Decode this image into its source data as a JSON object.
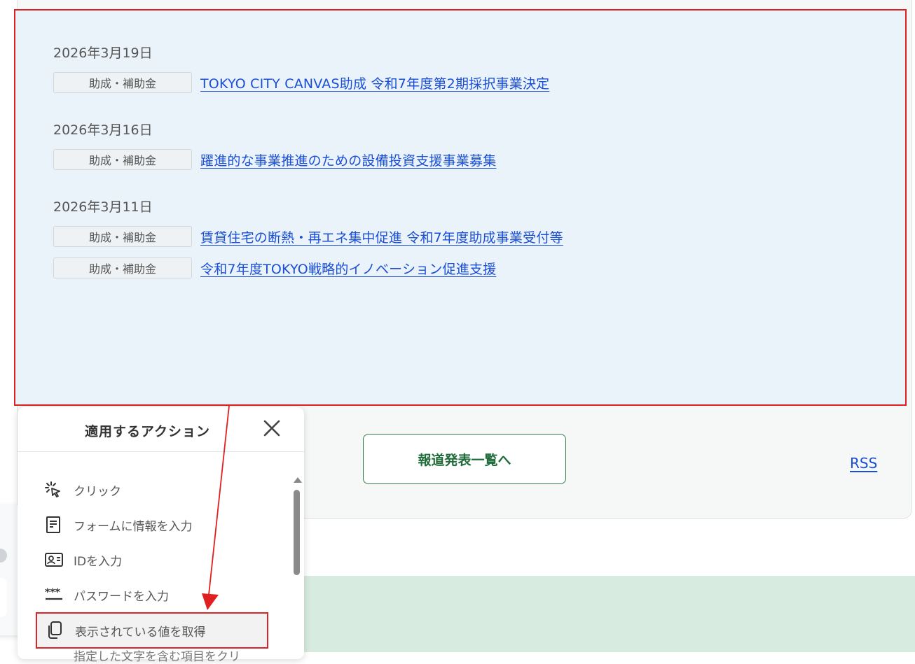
{
  "news": [
    {
      "date": "2026年3月19日",
      "items": [
        {
          "tag": "助成・補助金",
          "title": "TOKYO CITY CANVAS助成 令和7年度第2期採択事業決定"
        }
      ]
    },
    {
      "date": "2026年3月16日",
      "items": [
        {
          "tag": "助成・補助金",
          "title": "躍進的な事業推進のための設備投資支援事業募集"
        }
      ]
    },
    {
      "date": "2026年3月11日",
      "items": [
        {
          "tag": "助成・補助金",
          "title": "賃貸住宅の断熱・再エネ集中促進 令和7年度助成事業受付等"
        },
        {
          "tag": "助成・補助金",
          "title": "令和7年度TOKYO戦略的イノベーション促進支援"
        }
      ]
    }
  ],
  "list_button": "報道発表一覧へ",
  "rss_link": "RSS",
  "action_panel": {
    "title": "適用するアクション",
    "items": [
      {
        "icon": "click-cursor-icon",
        "label": "クリック"
      },
      {
        "icon": "form-icon",
        "label": "フォームに情報を入力"
      },
      {
        "icon": "id-card-icon",
        "label": "IDを入力"
      },
      {
        "icon": "password-icon",
        "label": "パスワードを入力"
      },
      {
        "icon": "copy-icon",
        "label": "表示されている値を取得"
      }
    ],
    "selected_index": 4,
    "truncated_item": "指定した文字を含む項目をクリ"
  },
  "colors": {
    "highlight": "#e02020",
    "link": "#1a4fd6",
    "brand_green": "#1f6b3a",
    "panel_bg": "#eaf2fa"
  }
}
